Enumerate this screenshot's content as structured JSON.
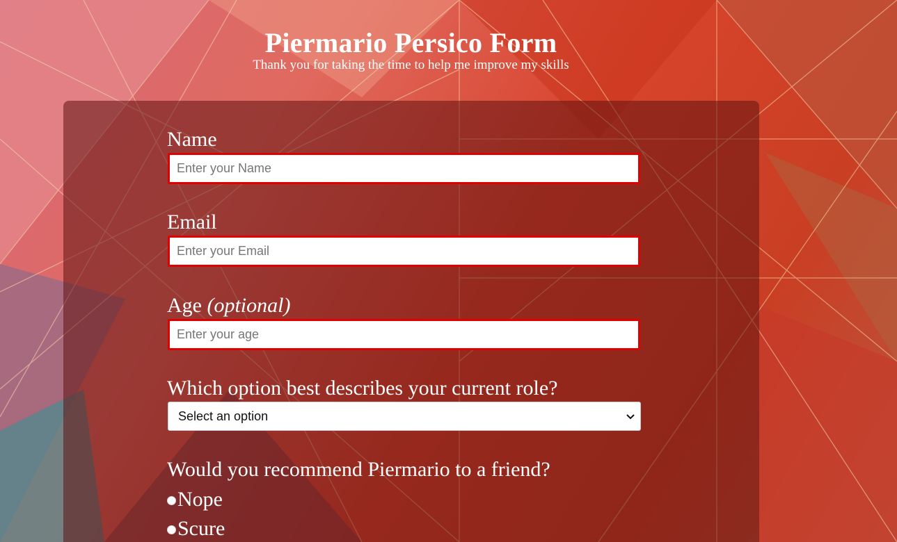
{
  "header": {
    "title": "Piermario Persico Form",
    "subtitle": "Thank you for taking the time to help me improve my skills"
  },
  "form": {
    "name": {
      "label": "Name",
      "placeholder": "Enter your Name"
    },
    "email": {
      "label": "Email",
      "placeholder": "Enter your Email"
    },
    "age": {
      "label": "Age",
      "label_suffix": "(optional)",
      "placeholder": "Enter your age"
    },
    "role": {
      "label": "Which option best describes your current role?",
      "selected": "Select an option"
    },
    "recommend": {
      "label": "Would you recommend Piermario to a friend?",
      "options": [
        "Nope",
        "Scure"
      ]
    }
  },
  "colors": {
    "input_border": "#e00000",
    "card_overlay": "rgba(96,18,18,0.55)",
    "text": "#ffffff"
  },
  "icons": {
    "select_arrow": "chevron-down-icon",
    "radio": "radio-icon"
  }
}
